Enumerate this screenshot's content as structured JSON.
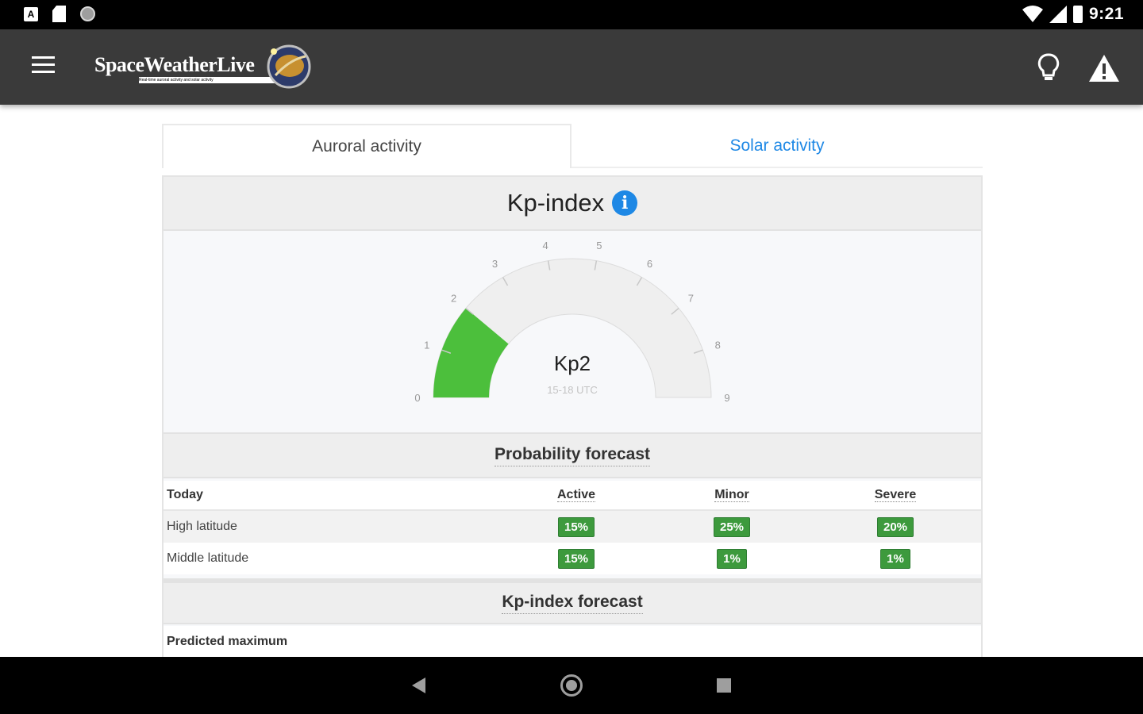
{
  "status_bar": {
    "time": "9:21"
  },
  "app_bar": {
    "logo_text": "SpaceWeatherLive",
    "logo_subtitle": "Real-time auroral activity and solar activity"
  },
  "tabs": [
    {
      "label": "Auroral activity",
      "active": true
    },
    {
      "label": "Solar activity",
      "active": false
    }
  ],
  "kp_card": {
    "title": "Kp-index",
    "gauge": {
      "value": 2,
      "max": 9,
      "label": "Kp2",
      "sublabel": "15-18 UTC",
      "ticks": [
        "0",
        "1",
        "2",
        "3",
        "4",
        "5",
        "6",
        "7",
        "8",
        "9"
      ],
      "fill_color": "#4cbf3c",
      "track_color": "#efefef"
    },
    "probability": {
      "title": "Probability forecast",
      "columns": [
        "Today",
        "Active",
        "Minor",
        "Severe"
      ],
      "rows": [
        {
          "label": "High latitude",
          "values": [
            "15%",
            "25%",
            "20%"
          ]
        },
        {
          "label": "Middle latitude",
          "values": [
            "15%",
            "1%",
            "1%"
          ]
        }
      ]
    },
    "kp_forecast": {
      "title": "Kp-index forecast",
      "first_row": "Predicted maximum"
    }
  }
}
